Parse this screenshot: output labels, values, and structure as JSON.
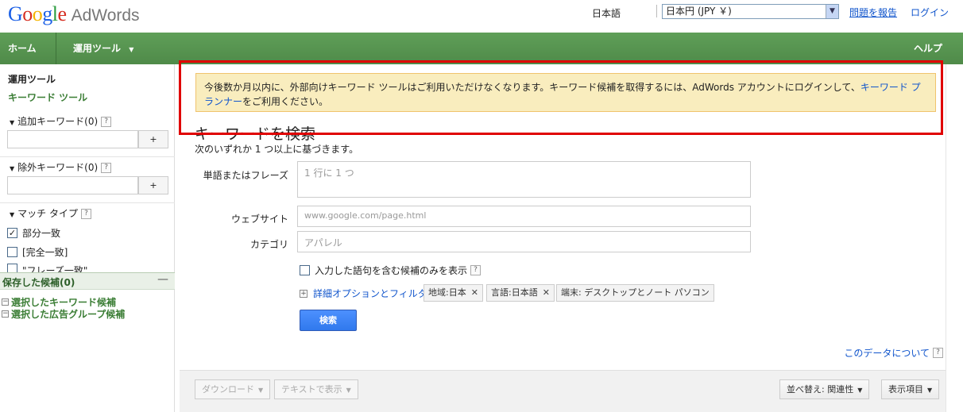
{
  "header": {
    "logo_google": "Google",
    "logo_product": "AdWords",
    "language": "日本語",
    "currency": "日本円 (JPY ￥)",
    "report_link": "問題を報告",
    "login_link": "ログイン"
  },
  "nav": {
    "home": "ホーム",
    "tools": "運用ツール",
    "help": "ヘルプ"
  },
  "sidebar": {
    "title": "運用ツール",
    "keyword_tool": "キーワード ツール",
    "add_keywords": "追加キーワード(0)",
    "exclude_keywords": "除外キーワード(0)",
    "match_type": "マッチ タイプ",
    "help_mark": "?",
    "plus": "+",
    "match_options": [
      {
        "label": "部分一致",
        "checked": true,
        "check_mark": "✓"
      },
      {
        "label": "[完全一致]",
        "checked": false,
        "check_mark": ""
      },
      {
        "label": "\"フレーズ一致\"",
        "checked": false,
        "check_mark": ""
      }
    ],
    "saved_title": "保存した候補(0)",
    "saved_minimize": "—",
    "tree_box": "−",
    "saved_keywords": "選択したキーワード候補",
    "saved_adgroups": "選択した広告グループ候補"
  },
  "notice": {
    "text": "今後数か月以内に、外部向けキーワード ツールはご利用いただけなくなります。キーワード候補を取得するには、AdWords アカウントにログインして、",
    "link": "キーワード プランナー",
    "suffix": "をご利用ください。"
  },
  "search": {
    "heading": "キーワードを検索",
    "subheading": "次のいずれか 1 つ以上に基づきます。",
    "word_label": "単語またはフレーズ",
    "word_placeholder": "1 行に 1 つ",
    "website_label": "ウェブサイト",
    "website_placeholder": "www.google.com/page.html",
    "category_label": "カテゴリ",
    "category_value": "アパレル",
    "only_terms": "入力した語句を含む候補のみを表示",
    "advanced_box": "+",
    "advanced": "詳細オプションとフィルタ",
    "chip_location": "地域:日本",
    "chip_language": "言語:日本語",
    "chip_device": "端末: デスクトップとノート パソコン",
    "chip_remove": "✕",
    "search_button": "検索"
  },
  "results": {
    "about_data": "このデータについて",
    "download": "ダウンロード",
    "show_text": "テキストで表示",
    "sort": "並べ替え: 関連性",
    "columns": "表示項目",
    "dropdown": "▼"
  }
}
